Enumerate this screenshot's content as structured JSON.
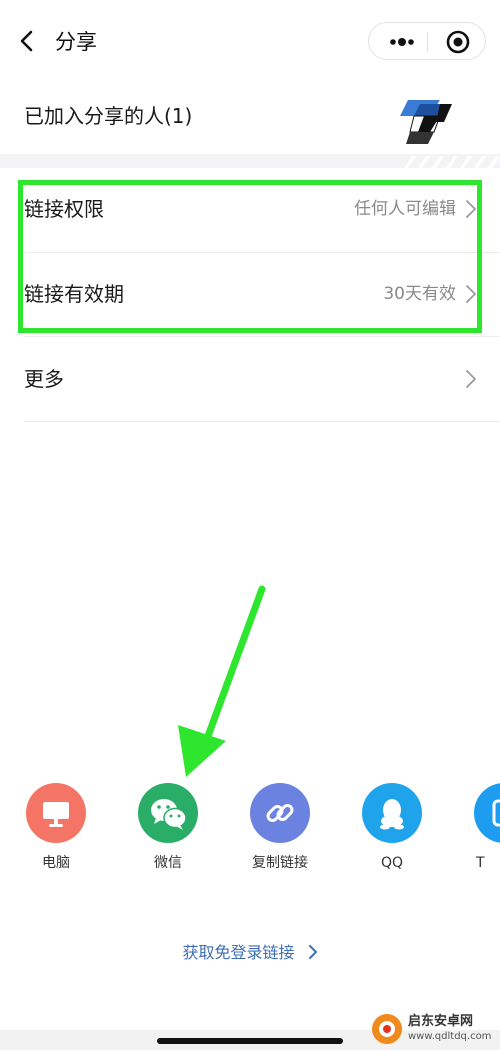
{
  "header": {
    "title": "分享",
    "back_icon": "back-arrow-icon",
    "more_icon": "more-dots-icon",
    "close_icon": "record-circle-icon"
  },
  "shared_people": {
    "label": "已加入分享的人(1)",
    "avatar_icon": "app-logo-avatar"
  },
  "settings": [
    {
      "id": "link-permission",
      "label": "链接权限",
      "value": "任何人可编辑"
    },
    {
      "id": "link-validity",
      "label": "链接有效期",
      "value": "30天有效"
    },
    {
      "id": "more",
      "label": "更多",
      "value": ""
    }
  ],
  "share_targets": [
    {
      "id": "computer",
      "label": "电脑",
      "icon": "monitor-icon",
      "color": "#f47566"
    },
    {
      "id": "wechat",
      "label": "微信",
      "icon": "wechat-icon",
      "color": "#2aae67"
    },
    {
      "id": "copy-link",
      "label": "复制链接",
      "icon": "link-icon",
      "color": "#6b82e0"
    },
    {
      "id": "qq",
      "label": "QQ",
      "icon": "qq-penguin-icon",
      "color": "#1fa4ec"
    },
    {
      "id": "tim",
      "label": "T",
      "icon": "tim-icon",
      "color": "#1e9cf0"
    }
  ],
  "login_free_link": {
    "label": "获取免登录链接"
  },
  "watermark": {
    "name": "启东安卓网",
    "url": "www.qdltdq.com"
  },
  "colors": {
    "highlight": "#2ee62e",
    "link": "#3f6fb5",
    "value_text": "#8a8a8a"
  }
}
